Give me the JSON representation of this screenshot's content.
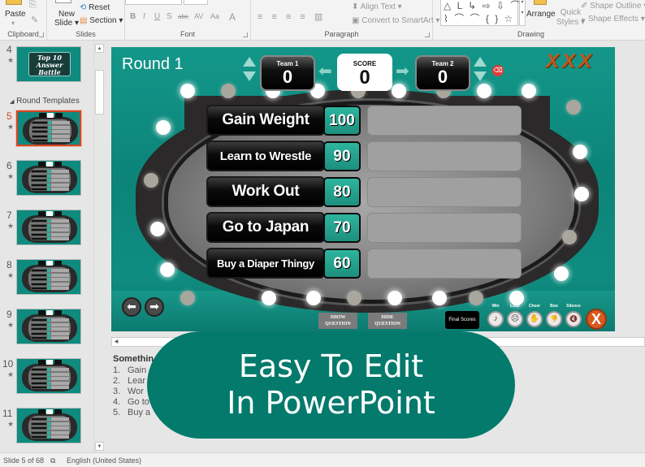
{
  "ribbon": {
    "clipboard": {
      "paste": "Paste",
      "label": "Clipboard"
    },
    "slides": {
      "new_slide_line1": "New",
      "new_slide_line2": "Slide",
      "reset": "Reset",
      "section": "Section",
      "label": "Slides"
    },
    "font": {
      "bold": "B",
      "italic": "I",
      "underline": "U",
      "shadow": "S",
      "strike": "abc",
      "spacing": "AV",
      "case": "Aa",
      "color": "A",
      "label": "Font"
    },
    "paragraph": {
      "align_text": "Align Text",
      "convert_smartart": "Convert to SmartArt",
      "label": "Paragraph"
    },
    "drawing": {
      "shapes_row1": "△ L ↳ ⇨ ⇩ ⌒",
      "shapes_row2": "⌇ ⌒ ⌒ { } ☆",
      "arrange": "Arrange",
      "quick_styles_1": "Quick",
      "quick_styles_2": "Styles",
      "shape_outline": "Shape Outline",
      "shape_effects": "Shape Effects",
      "label": "Drawing"
    }
  },
  "thumbnails": {
    "section_header": "Round Templates",
    "slides": [
      {
        "number": "4",
        "title_sign": "Top 10 Answer Battle"
      },
      {
        "number": "5",
        "selected": true
      },
      {
        "number": "6"
      },
      {
        "number": "7"
      },
      {
        "number": "8"
      },
      {
        "number": "9"
      },
      {
        "number": "10"
      },
      {
        "number": "11"
      }
    ]
  },
  "slide": {
    "round_title": "Round 1",
    "strikes": "XXX",
    "team1": {
      "label": "Team 1",
      "score": "0"
    },
    "center": {
      "label": "SCORE",
      "score": "0"
    },
    "team2": {
      "label": "Team 2",
      "score": "0"
    },
    "answers": [
      {
        "text": "Gain Weight",
        "points": "100"
      },
      {
        "text": "Learn to Wrestle",
        "points": "90"
      },
      {
        "text": "Work Out",
        "points": "80"
      },
      {
        "text": "Go to Japan",
        "points": "70"
      },
      {
        "text": "Buy a Diaper Thingy",
        "points": "60"
      }
    ],
    "show_question": "SHOW QUESTION",
    "hide_question": "HIDE QUESTION",
    "final_scores": "Final Scores",
    "sounds": [
      {
        "label": "Win",
        "icon": "♪"
      },
      {
        "label": "Lose",
        "icon": "☹"
      },
      {
        "label": "Cheer",
        "icon": "✋"
      },
      {
        "label": "Boo",
        "icon": "👎"
      },
      {
        "label": "Silence",
        "icon": "🔇"
      }
    ],
    "close": "X"
  },
  "notes": {
    "title": "Somethin",
    "items": [
      {
        "n": "1.",
        "text": "Gain"
      },
      {
        "n": "2.",
        "text": "Lear"
      },
      {
        "n": "3.",
        "text": "Wor"
      },
      {
        "n": "4.",
        "text": "Go to"
      },
      {
        "n": "5.",
        "text": "Buy a"
      }
    ]
  },
  "overlay": {
    "line1": "Easy To Edit",
    "line2": "In PowerPoint",
    "color": "#037a6c"
  },
  "status": {
    "slide_count": "Slide 5 of 68",
    "language": "English (United States)"
  }
}
